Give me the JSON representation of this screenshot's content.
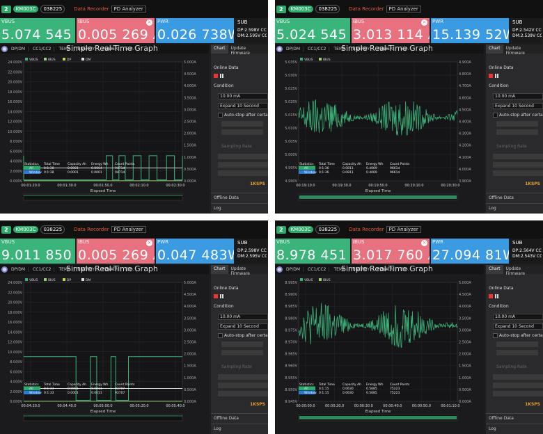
{
  "panels": [
    {
      "device": {
        "number": "2",
        "name": "KM003C",
        "serial": "038225"
      },
      "toolbar": {
        "recorder": "Data Recorder",
        "analyzer": "PD Analyzer"
      },
      "vbus": {
        "label": "VBUS",
        "value": "5.074 545 V"
      },
      "ibus": {
        "label": "IBUS",
        "value": "0.005 269 A"
      },
      "pwr": {
        "label": "PWR",
        "value": "0.026 738W"
      },
      "sub": {
        "label": "SUB",
        "line1": "DP:2.598V CC1",
        "line2": "DM:2.595V CC2"
      },
      "graph": {
        "tabs": [
          "DP/DM",
          "CC1/CC2",
          "TEMP",
          "ENERGY",
          "POWER",
          "E.D."
        ],
        "title": "Simple Real-Time Graph",
        "legend": [
          "VBUS",
          "IBUS",
          "DP",
          "DM"
        ]
      },
      "side": {
        "tabs": [
          "Chart",
          "Update Firmware"
        ],
        "online": "Online Data",
        "condition": "Condition",
        "current": "10.00 mA",
        "expand": "Expand 10 Second",
        "autostop": "Auto-stop after certain",
        "sampling": "Sampling Rate",
        "sps": "1KSPS",
        "offline": "Offline Data",
        "log": "Log"
      }
    },
    {
      "device": {
        "number": "2",
        "name": "KM003C",
        "serial": "038225"
      },
      "toolbar": {
        "recorder": "Data Recorder",
        "analyzer": "PD Analyzer"
      },
      "vbus": {
        "label": "VBUS",
        "value": "5.024 545 V"
      },
      "ibus": {
        "label": "IBUS",
        "value": "3.013 114 A"
      },
      "pwr": {
        "label": "PWR",
        "value": "15.139 52W"
      },
      "sub": {
        "label": "SUB",
        "line1": "DP:2.542V CC",
        "line2": "DM:2.539V CC"
      },
      "graph": {
        "tabs": [
          "DP/DM",
          "CC1/CC2",
          "TEMP",
          "ENERGY",
          "POWER",
          "E.D."
        ],
        "title": "Simple Real-Time Graph",
        "legend": [
          "VBUS",
          "IBUS"
        ]
      },
      "side": {
        "tabs": [
          "Chart",
          "Update Firmware"
        ],
        "online": "Online Data",
        "condition": "Condition",
        "current": "10.00 mA",
        "expand": "Expand 10 Second",
        "autostop": "Auto-stop after certain",
        "sampling": "Sampling Rate",
        "sps": "1KSPS",
        "offline": "Offline Data",
        "log": "Log"
      }
    },
    {
      "device": {
        "number": "2",
        "name": "KM003C",
        "serial": "038225"
      },
      "toolbar": {
        "recorder": "Data Recorder",
        "analyzer": "PD Analyzer"
      },
      "vbus": {
        "label": "VBUS",
        "value": "9.011 850 V"
      },
      "ibus": {
        "label": "IBUS",
        "value": "0.005 269 A"
      },
      "pwr": {
        "label": "PWR",
        "value": "0.047 483W"
      },
      "sub": {
        "label": "SUB",
        "line1": "DP:2.598V CC1",
        "line2": "DM:2.595V CC2"
      },
      "graph": {
        "tabs": [
          "DP/DM",
          "CC1/CC2",
          "TEMP",
          "ENERGY",
          "POWER",
          "E.D."
        ],
        "title": "Simple Real-Time Graph",
        "legend": [
          "VBUS",
          "IBUS",
          "DP",
          "DM"
        ]
      },
      "side": {
        "tabs": [
          "Chart",
          "Update Firmware"
        ],
        "online": "Online Data",
        "condition": "Condition",
        "current": "10.00 mA",
        "expand": "Expand 10 Second",
        "autostop": "Auto-stop after certain",
        "sampling": "Sampling Rate",
        "sps": "1KSPS",
        "offline": "Offline Data",
        "log": "Log"
      }
    },
    {
      "device": {
        "number": "2",
        "name": "KM003C",
        "serial": "038225"
      },
      "toolbar": {
        "recorder": "Data Recorder",
        "analyzer": "PD Analyzer"
      },
      "vbus": {
        "label": "VBUS",
        "value": "8.978 451 V"
      },
      "ibus": {
        "label": "IBUS",
        "value": "3.017 760 A"
      },
      "pwr": {
        "label": "PWR",
        "value": "27.094 81W"
      },
      "sub": {
        "label": "SUB",
        "line1": "DP:2.564V CC",
        "line2": "DM:2.543V CC"
      },
      "graph": {
        "tabs": [
          "DP/DM",
          "CC1/CC2",
          "TEMP",
          "ENERGY",
          "POWER",
          "E.D."
        ],
        "title": "Simple Real-Time Graph",
        "legend": [
          "VBUS",
          "IBUS"
        ]
      },
      "side": {
        "tabs": [
          "Chart",
          "Update Firmware"
        ],
        "online": "Online Data",
        "condition": "Condition",
        "current": "10.00 mA",
        "expand": "Expand 10 Second",
        "autostop": "Auto-stop after certain",
        "sampling": "Sampling Rate",
        "sps": "1KSPS",
        "offline": "Offline Data",
        "log": "Log"
      }
    }
  ],
  "chart_data": [
    {
      "type": "line",
      "title": "Simple Real-Time Graph",
      "xlabel": "Elapsed Time",
      "x_ticks": [
        "00:01:20.0",
        "00:01:30.0",
        "00:01:50.0",
        "00:02:10.0",
        "00:02:30.0"
      ],
      "y_ticks_left": [
        "0.000V",
        "2.000V",
        "4.000V",
        "6.000V",
        "8.000V",
        "10.000V",
        "12.000V",
        "14.000V",
        "16.000V",
        "18.000V",
        "20.000V",
        "22.000V",
        "24.000V"
      ],
      "y_ticks_right": [
        "0.000A",
        "0.500A",
        "1.000A",
        "1.500A",
        "2.000A",
        "2.500A",
        "3.000A",
        "3.500A",
        "4.000A",
        "4.500A",
        "5.000A"
      ],
      "ylim": [
        0,
        24
      ],
      "ylim_right": [
        0,
        5
      ],
      "series": [
        {
          "name": "VBUS",
          "color": "#3ab47a",
          "shape": "pulses",
          "base": 0.2,
          "high": 5.07
        },
        {
          "name": "IBUS",
          "color": "#9ad07a",
          "shape": "flat",
          "level": 0.02
        },
        {
          "name": "DP",
          "color": "#c8d84a",
          "shape": "flat",
          "level": 2.6
        },
        {
          "name": "DM",
          "color": "#e0e0e0",
          "shape": "flat",
          "level": 2.6
        }
      ],
      "stats": {
        "headers": [
          "Statistics",
          "Total Time",
          "Capacity Ah",
          "Energy Wh",
          "Count Points"
        ],
        "rows": [
          [
            "All",
            "0:1:38",
            "0.0001",
            "0.0004",
            "9471d"
          ],
          [
            "Window",
            "0:1:38",
            "0.0001",
            "0.0001",
            "9471d"
          ]
        ]
      }
    },
    {
      "type": "line",
      "title": "Simple Real-Time Graph",
      "xlabel": "Elapsed Time",
      "x_ticks": [
        "00:19:10.0",
        "00:19:30.0",
        "00:19:50.0",
        "00:20:10.0",
        "00:20:30.0"
      ],
      "y_ticks_left": [
        "4.990V",
        "4.995V",
        "5.000V",
        "5.005V",
        "5.010V",
        "5.015V",
        "5.020V",
        "5.025V",
        "5.030V",
        "5.035V"
      ],
      "y_ticks_right": [
        "3.900A",
        "4.000A",
        "4.100A",
        "4.200A",
        "4.300A",
        "4.400A",
        "4.500A",
        "4.600A",
        "4.700A",
        "4.800A",
        "4.900A"
      ],
      "ylim": [
        4.99,
        5.035
      ],
      "series": [
        {
          "name": "VBUS",
          "color": "#3ab47a",
          "shape": "noise",
          "center": 5.014,
          "amp": 0.0075
        }
      ],
      "stats": {
        "headers": [
          "Statistics",
          "Total Time",
          "Capacity Ah",
          "Energy Wh",
          "Count Points"
        ],
        "rows": [
          [
            "All",
            "0:1:36",
            "0.0811",
            "0.4069",
            "9661d"
          ],
          [
            "Window",
            "0:1:36",
            "0.0811",
            "0.4069",
            "9661d"
          ]
        ]
      }
    },
    {
      "type": "line",
      "title": "Simple Real-Time Graph",
      "xlabel": "Elapsed Time",
      "x_ticks": [
        "00:04:20.0",
        "00:04:40.0",
        "00:05:00.0",
        "00:05:20.0",
        "00:05:40.0"
      ],
      "y_ticks_left": [
        "0.000V",
        "2.000V",
        "4.000V",
        "6.000V",
        "8.000V",
        "10.000V",
        "12.000V",
        "14.000V",
        "16.000V",
        "18.000V",
        "20.000V",
        "22.000V",
        "24.000V"
      ],
      "y_ticks_right": [
        "0.000A",
        "0.500A",
        "1.000A",
        "1.500A",
        "2.000A",
        "2.500A",
        "3.000A",
        "3.500A",
        "4.000A",
        "4.500A",
        "5.000A"
      ],
      "ylim": [
        0,
        24
      ],
      "series": [
        {
          "name": "VBUS",
          "color": "#3ab47a",
          "shape": "step",
          "base": 0.2,
          "high": 9.01
        },
        {
          "name": "IBUS",
          "color": "#9ad07a",
          "shape": "flat",
          "level": 0.02
        },
        {
          "name": "DP",
          "color": "#c8d84a",
          "shape": "flat",
          "level": 2.6
        },
        {
          "name": "DM",
          "color": "#e0e0e0",
          "shape": "flat",
          "level": 2.6
        }
      ],
      "stats": {
        "headers": [
          "Statistics",
          "Total Time",
          "Capacity Ah",
          "Energy Wh",
          "Count Points"
        ],
        "rows": [
          [
            "All",
            "0:1:33",
            "0.0001",
            "0.0011",
            "93707"
          ],
          [
            "Window",
            "0:1:33",
            "0.0001",
            "0.0011",
            "93707"
          ]
        ]
      }
    },
    {
      "type": "line",
      "title": "Simple Real-Time Graph",
      "xlabel": "Elapsed Time",
      "x_ticks": [
        "00:00:00.0",
        "00:00:20.0",
        "00:00:30.0",
        "00:00:40.0",
        "00:00:50.0",
        "00:01:10.0"
      ],
      "y_ticks_left": [
        "8.945V",
        "8.950V",
        "8.955V",
        "8.960V",
        "8.965V",
        "8.970V",
        "8.975V",
        "8.980V",
        "8.985V",
        "8.990V",
        "8.995V"
      ],
      "y_ticks_right": [
        "0.000A",
        "0.500A",
        "1.000A",
        "1.500A",
        "2.000A",
        "2.500A",
        "3.000A",
        "3.500A",
        "4.000A",
        "4.500A",
        "5.000A"
      ],
      "ylim": [
        8.945,
        8.995
      ],
      "series": [
        {
          "name": "VBUS",
          "color": "#3ab47a",
          "shape": "noise",
          "center": 8.977,
          "amp": 0.0095
        }
      ],
      "stats": {
        "headers": [
          "Statistics",
          "Total Time",
          "Capacity Ah",
          "Energy Wh",
          "Count Points"
        ],
        "rows": [
          [
            "All",
            "0:1:15",
            "0.0630",
            "0.5685",
            "75223"
          ],
          [
            "Window",
            "0:1:15",
            "0.0630",
            "0.5685",
            "75223"
          ]
        ]
      }
    }
  ]
}
